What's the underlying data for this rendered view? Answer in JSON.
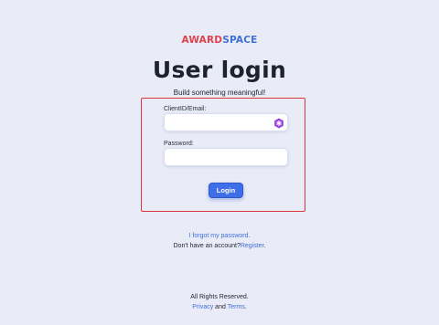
{
  "brand": {
    "part1": "AWARD",
    "part2": "SPACE"
  },
  "title": "User login",
  "subtitle": "Build something meaningful!",
  "form": {
    "client_label": "ClientID/Email:",
    "client_value": "",
    "password_label": "Password:",
    "password_value": "",
    "extension_icon": "password-manager-icon",
    "login_label": "Login"
  },
  "links": {
    "forgot": "I forgot my password.",
    "no_account": "Don't have an account?",
    "register": "Register",
    "register_suffix": "."
  },
  "footer": {
    "rights": "All Rights Reserved.",
    "privacy": "Privacy",
    "and": " and ",
    "terms": "Terms",
    "suffix": "."
  },
  "colors": {
    "background": "#e9ecf6",
    "accent": "#3f6fe8",
    "brand_red": "#e0434f",
    "highlight_border": "#e0343c"
  }
}
